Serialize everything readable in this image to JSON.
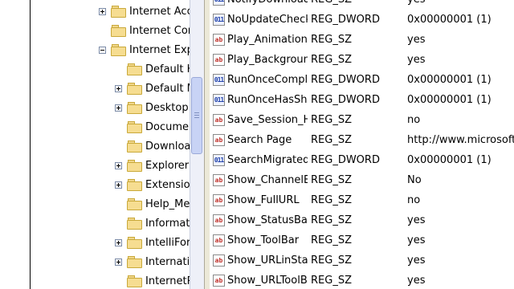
{
  "tree": {
    "items": [
      {
        "label": "Internet Accoun",
        "expander": "plus",
        "level": 0
      },
      {
        "label": "Internet Connec",
        "expander": "none",
        "level": 0
      },
      {
        "label": "Internet Explorer",
        "expander": "minus",
        "level": 0
      },
      {
        "label": "Default HTM",
        "expander": "none",
        "level": 1
      },
      {
        "label": "Default MHT",
        "expander": "plus",
        "level": 1
      },
      {
        "label": "Desktop",
        "expander": "plus",
        "level": 1
      },
      {
        "label": "Document V",
        "expander": "none",
        "level": 1
      },
      {
        "label": "Download",
        "expander": "none",
        "level": 1
      },
      {
        "label": "Explorer Bar",
        "expander": "plus",
        "level": 1
      },
      {
        "label": "Extensions",
        "expander": "plus",
        "level": 1
      },
      {
        "label": "Help_Menu_",
        "expander": "none",
        "level": 1
      },
      {
        "label": "InformationB",
        "expander": "none",
        "level": 1
      },
      {
        "label": "IntelliForms",
        "expander": "plus",
        "level": 1
      },
      {
        "label": "Internationa",
        "expander": "plus",
        "level": 1
      },
      {
        "label": "InternetReg",
        "expander": "none",
        "level": 1
      }
    ]
  },
  "values": {
    "rows": [
      {
        "icon": "dword-icon",
        "name": "NotifyDownloadC",
        "type": "REG_SZ",
        "data": "yes"
      },
      {
        "icon": "dword-icon",
        "name": "NoUpdateCheck",
        "type": "REG_DWORD",
        "data": "0x00000001 (1)"
      },
      {
        "icon": "sz-icon",
        "name": "Play_Animations",
        "type": "REG_SZ",
        "data": "yes"
      },
      {
        "icon": "sz-icon",
        "name": "Play_Background...",
        "type": "REG_SZ",
        "data": "yes"
      },
      {
        "icon": "dword-icon",
        "name": "RunOnceComplete",
        "type": "REG_DWORD",
        "data": "0x00000001 (1)"
      },
      {
        "icon": "dword-icon",
        "name": "RunOnceHasSho...",
        "type": "REG_DWORD",
        "data": "0x00000001 (1)"
      },
      {
        "icon": "sz-icon",
        "name": "Save_Session_Hi...",
        "type": "REG_SZ",
        "data": "no"
      },
      {
        "icon": "sz-icon",
        "name": "Search Page",
        "type": "REG_SZ",
        "data": "http://www.microsoft.com/is"
      },
      {
        "icon": "dword-icon",
        "name": "SearchMigrated",
        "type": "REG_DWORD",
        "data": "0x00000001 (1)"
      },
      {
        "icon": "sz-icon",
        "name": "Show_ChannelBa...",
        "type": "REG_SZ",
        "data": "No"
      },
      {
        "icon": "sz-icon",
        "name": "Show_FullURL",
        "type": "REG_SZ",
        "data": "no"
      },
      {
        "icon": "sz-icon",
        "name": "Show_StatusBar",
        "type": "REG_SZ",
        "data": "yes"
      },
      {
        "icon": "sz-icon",
        "name": "Show_ToolBar",
        "type": "REG_SZ",
        "data": "yes"
      },
      {
        "icon": "sz-icon",
        "name": "Show_URLinStat...",
        "type": "REG_SZ",
        "data": "yes"
      },
      {
        "icon": "sz-icon",
        "name": "Show_URLToolBar",
        "type": "REG_SZ",
        "data": "yes"
      }
    ]
  },
  "icon_glyphs": {
    "sz": "ab",
    "dword": "011"
  },
  "colors": {
    "splitter": "#ece9d8",
    "scroll_thumb": "#c8d3f5",
    "folder": "#f6dd91"
  }
}
